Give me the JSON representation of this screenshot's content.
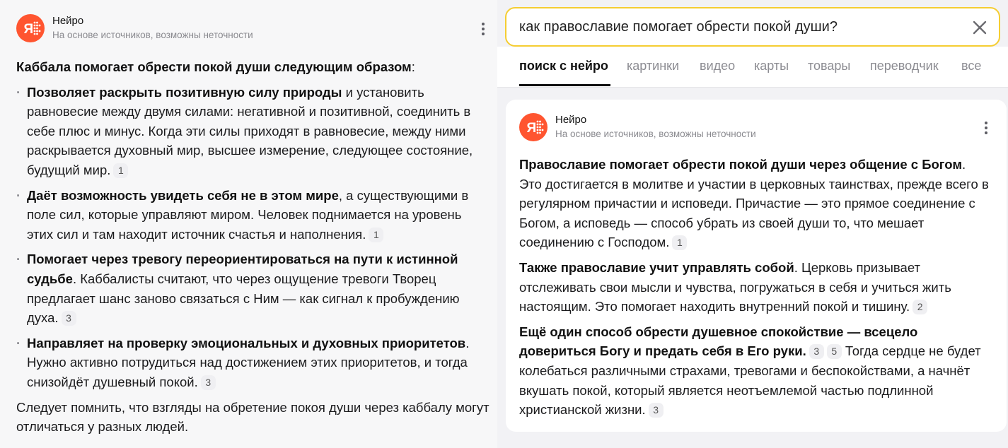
{
  "left": {
    "neuro": {
      "title": "Нейро",
      "subtitle": "На основе источников, возможны неточности"
    },
    "intro_bold": "Каббала помогает обрести покой души следующим образом",
    "intro_tail": ":",
    "bullets": [
      {
        "bold": "Позволяет раскрыть позитивную силу природы",
        "text": " и установить равновесие между двумя силами: негативной и позитивной, соединить в себе плюс и минус. Когда эти силы приходят в равновесие, между ними раскрывается духовный мир, высшее измерение, следующее состояние, будущий мир.",
        "ref": "1"
      },
      {
        "bold": "Даёт возможность увидеть себя не в этом мире",
        "text": ", а существующими в поле сил, которые управляют миром. Человек поднимается на уровень этих сил и там находит источник счастья и наполнения.",
        "ref": "1"
      },
      {
        "bold": "Помогает через тревогу переориентироваться на пути к истинной судьбе",
        "text": ". Каббалисты считают, что через ощущение тревоги Творец предлагает шанс заново связаться с Ним — как сигнал к пробуждению духа.",
        "ref": "3"
      },
      {
        "bold": "Направляет на проверку эмоциональных и духовных приоритетов",
        "text": ". Нужно активно потрудиться над достижением этих приоритетов, и тогда снизойдёт душевный покой.",
        "ref": "3"
      }
    ],
    "outro": "Следует помнить, что взгляды на обретение покоя души через каббалу могут отличаться у разных людей."
  },
  "right": {
    "search": {
      "query": "как православие помогает обрести покой души?"
    },
    "tabs": [
      {
        "label": "поиск с нейро",
        "active": true
      },
      {
        "label": "картинки"
      },
      {
        "label": "видео"
      },
      {
        "label": "карты"
      },
      {
        "label": "товары"
      },
      {
        "label": "переводчик"
      },
      {
        "label": "все"
      }
    ],
    "neuro": {
      "title": "Нейро",
      "subtitle": "На основе источников, возможны неточности"
    },
    "para1": {
      "bold": "Православие помогает обрести покой души через общение с Богом",
      "text": ". Это достигается в молитве и участии в церковных таинствах, прежде всего в регулярном причастии и исповеди. Причастие — это прямое соединение с Богом, а исповедь — способ убрать из своей души то, что мешает соединению с Господом.",
      "ref": "1"
    },
    "para2": {
      "bold": "Также православие учит управлять собой",
      "text": ". Церковь призывает отслеживать свои мысли и чувства, погружаться в себя и учиться жить настоящим. Это помогает находить внутренний покой и тишину.",
      "ref": "2"
    },
    "para3": {
      "bold": "Ещё один способ обрести душевное спокойствие — всецело довериться Богу и предать себя в Его руки",
      "text_before": ".",
      "refs": [
        "3",
        "5"
      ],
      "text": " Тогда сердце не будет колебаться различными страхами, тревогами и беспокойствами, а начнёт вкушать покой, который является неотъемлемой частью подлинной христианской жизни.",
      "ref": "3"
    }
  },
  "colors": {
    "accent_logo": "#ff5530",
    "search_border": "#f5cd32"
  }
}
